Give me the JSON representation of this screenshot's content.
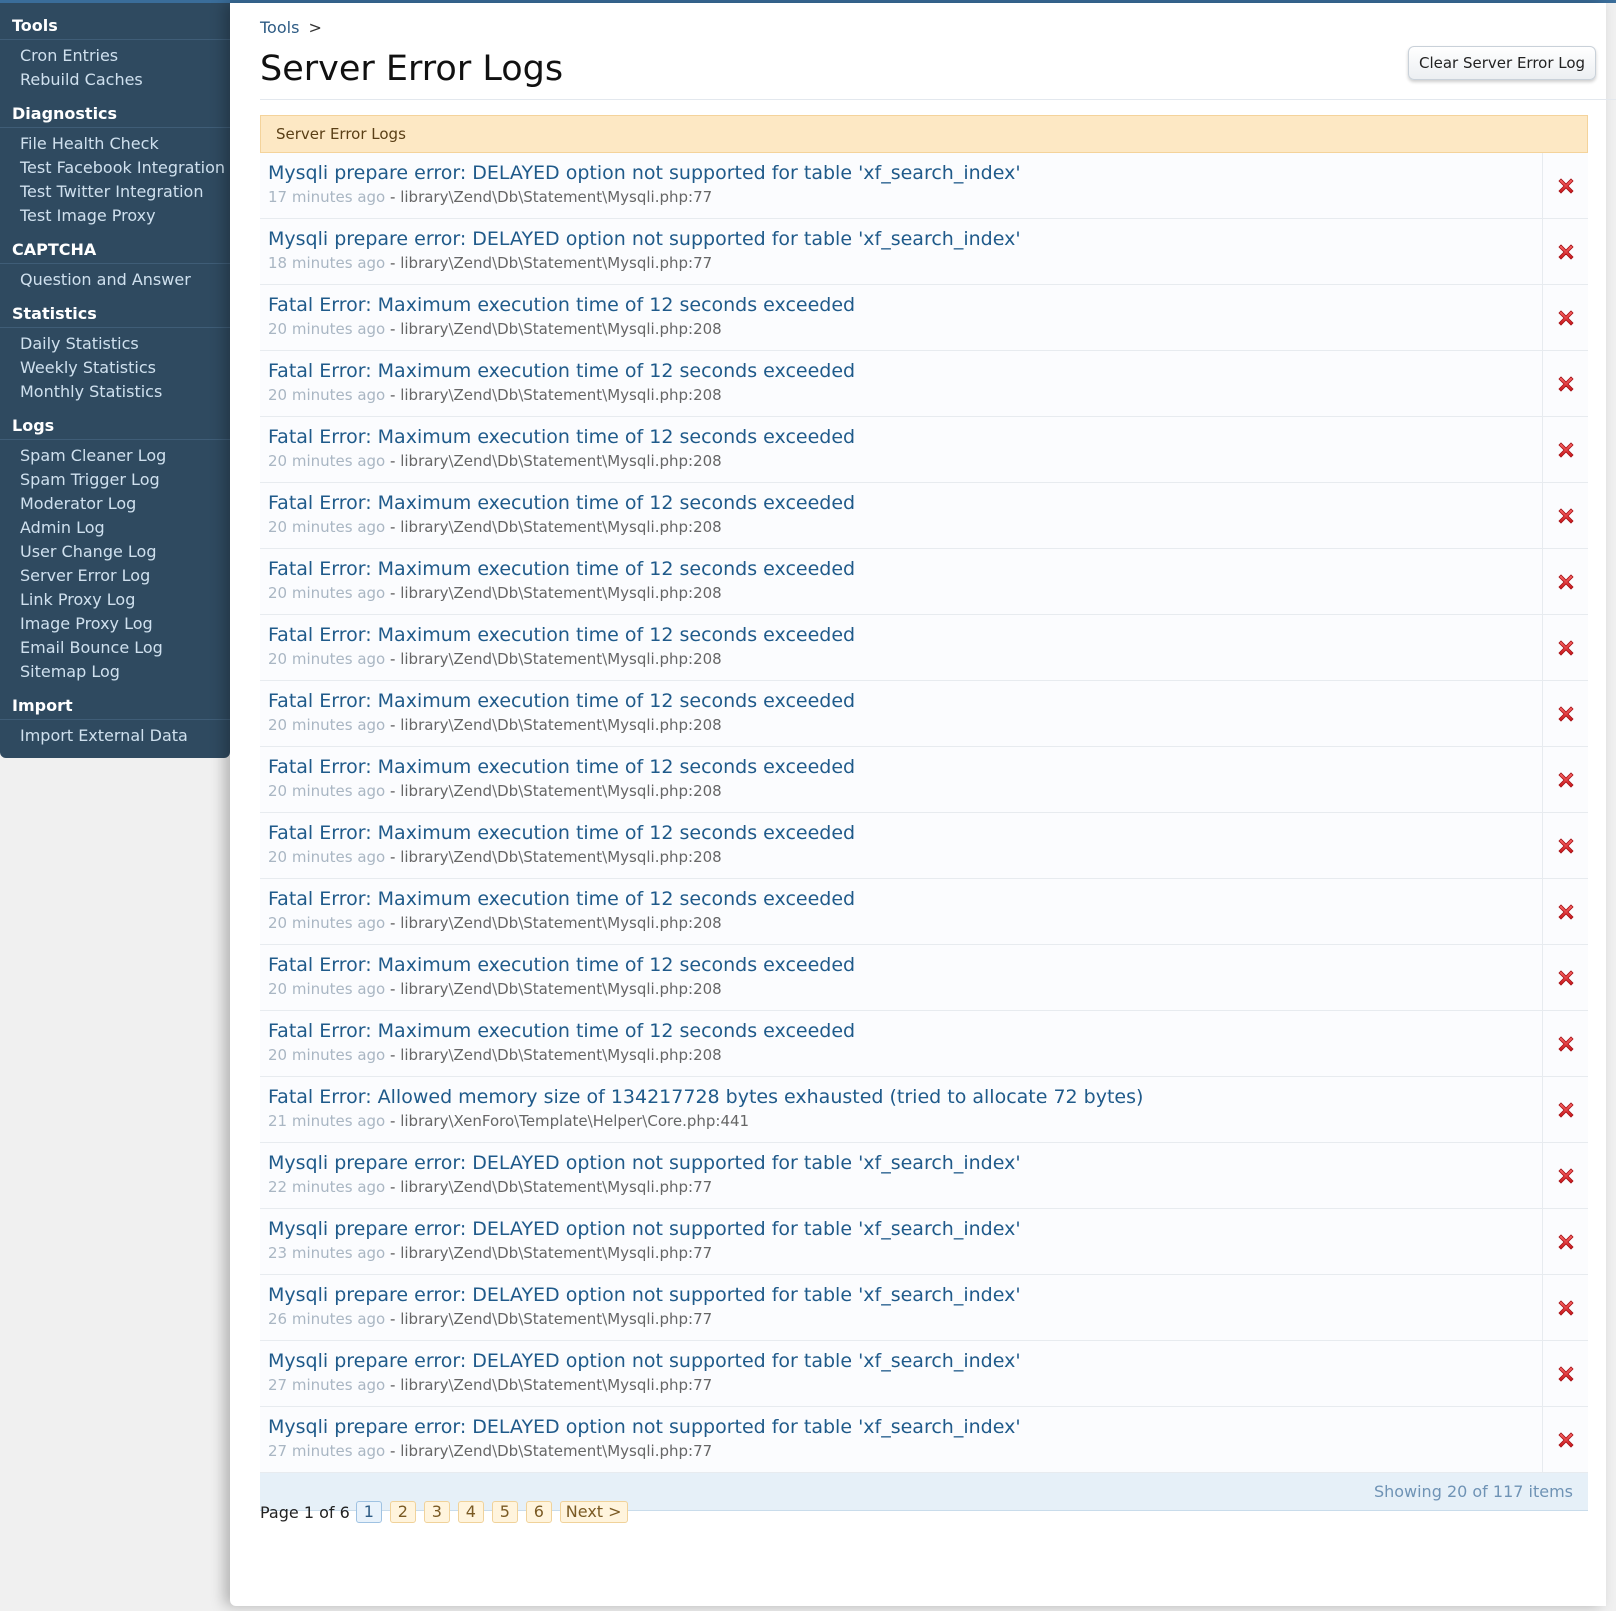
{
  "sidebar": {
    "sections": [
      {
        "title": "Tools",
        "items": [
          "Cron Entries",
          "Rebuild Caches"
        ]
      },
      {
        "title": "Diagnostics",
        "items": [
          "File Health Check",
          "Test Facebook Integration",
          "Test Twitter Integration",
          "Test Image Proxy"
        ]
      },
      {
        "title": "CAPTCHA",
        "items": [
          "Question and Answer"
        ]
      },
      {
        "title": "Statistics",
        "items": [
          "Daily Statistics",
          "Weekly Statistics",
          "Monthly Statistics"
        ]
      },
      {
        "title": "Logs",
        "items": [
          "Spam Cleaner Log",
          "Spam Trigger Log",
          "Moderator Log",
          "Admin Log",
          "User Change Log",
          "Server Error Log",
          "Link Proxy Log",
          "Image Proxy Log",
          "Email Bounce Log",
          "Sitemap Log"
        ]
      },
      {
        "title": "Import",
        "items": [
          "Import External Data"
        ]
      }
    ]
  },
  "breadcrumb": {
    "item": "Tools",
    "separator": ">"
  },
  "page": {
    "title": "Server Error Logs",
    "clear_button": "Clear Server Error Log",
    "panel_header": "Server Error Logs"
  },
  "logs": [
    {
      "message": "Mysqli prepare error: DELAYED option not supported for table 'xf_search_index'",
      "time": "17 minutes ago",
      "file": "library\\Zend\\Db\\Statement\\Mysqli.php:77"
    },
    {
      "message": "Mysqli prepare error: DELAYED option not supported for table 'xf_search_index'",
      "time": "18 minutes ago",
      "file": "library\\Zend\\Db\\Statement\\Mysqli.php:77"
    },
    {
      "message": "Fatal Error: Maximum execution time of 12 seconds exceeded",
      "time": "20 minutes ago",
      "file": "library\\Zend\\Db\\Statement\\Mysqli.php:208"
    },
    {
      "message": "Fatal Error: Maximum execution time of 12 seconds exceeded",
      "time": "20 minutes ago",
      "file": "library\\Zend\\Db\\Statement\\Mysqli.php:208"
    },
    {
      "message": "Fatal Error: Maximum execution time of 12 seconds exceeded",
      "time": "20 minutes ago",
      "file": "library\\Zend\\Db\\Statement\\Mysqli.php:208"
    },
    {
      "message": "Fatal Error: Maximum execution time of 12 seconds exceeded",
      "time": "20 minutes ago",
      "file": "library\\Zend\\Db\\Statement\\Mysqli.php:208"
    },
    {
      "message": "Fatal Error: Maximum execution time of 12 seconds exceeded",
      "time": "20 minutes ago",
      "file": "library\\Zend\\Db\\Statement\\Mysqli.php:208"
    },
    {
      "message": "Fatal Error: Maximum execution time of 12 seconds exceeded",
      "time": "20 minutes ago",
      "file": "library\\Zend\\Db\\Statement\\Mysqli.php:208"
    },
    {
      "message": "Fatal Error: Maximum execution time of 12 seconds exceeded",
      "time": "20 minutes ago",
      "file": "library\\Zend\\Db\\Statement\\Mysqli.php:208"
    },
    {
      "message": "Fatal Error: Maximum execution time of 12 seconds exceeded",
      "time": "20 minutes ago",
      "file": "library\\Zend\\Db\\Statement\\Mysqli.php:208"
    },
    {
      "message": "Fatal Error: Maximum execution time of 12 seconds exceeded",
      "time": "20 minutes ago",
      "file": "library\\Zend\\Db\\Statement\\Mysqli.php:208"
    },
    {
      "message": "Fatal Error: Maximum execution time of 12 seconds exceeded",
      "time": "20 minutes ago",
      "file": "library\\Zend\\Db\\Statement\\Mysqli.php:208"
    },
    {
      "message": "Fatal Error: Maximum execution time of 12 seconds exceeded",
      "time": "20 minutes ago",
      "file": "library\\Zend\\Db\\Statement\\Mysqli.php:208"
    },
    {
      "message": "Fatal Error: Maximum execution time of 12 seconds exceeded",
      "time": "20 minutes ago",
      "file": "library\\Zend\\Db\\Statement\\Mysqli.php:208"
    },
    {
      "message": "Fatal Error: Allowed memory size of 134217728 bytes exhausted (tried to allocate 72 bytes)",
      "time": "21 minutes ago",
      "file": "library\\XenForo\\Template\\Helper\\Core.php:441"
    },
    {
      "message": "Mysqli prepare error: DELAYED option not supported for table 'xf_search_index'",
      "time": "22 minutes ago",
      "file": "library\\Zend\\Db\\Statement\\Mysqli.php:77"
    },
    {
      "message": "Mysqli prepare error: DELAYED option not supported for table 'xf_search_index'",
      "time": "23 minutes ago",
      "file": "library\\Zend\\Db\\Statement\\Mysqli.php:77"
    },
    {
      "message": "Mysqli prepare error: DELAYED option not supported for table 'xf_search_index'",
      "time": "26 minutes ago",
      "file": "library\\Zend\\Db\\Statement\\Mysqli.php:77"
    },
    {
      "message": "Mysqli prepare error: DELAYED option not supported for table 'xf_search_index'",
      "time": "27 minutes ago",
      "file": "library\\Zend\\Db\\Statement\\Mysqli.php:77"
    },
    {
      "message": "Mysqli prepare error: DELAYED option not supported for table 'xf_search_index'",
      "time": "27 minutes ago",
      "file": "library\\Zend\\Db\\Statement\\Mysqli.php:77"
    }
  ],
  "meta_separator": "-",
  "delete_icon": "delete-x-icon",
  "footer": {
    "summary": "Showing 20 of 117 items"
  },
  "pagination": {
    "label": "Page 1 of 6",
    "pages": [
      "1",
      "2",
      "3",
      "4",
      "5",
      "6"
    ],
    "current": "1",
    "next": "Next >"
  },
  "colors": {
    "sidebar_bg": "#2f4a60",
    "link": "#1f5a8a",
    "panel_header_bg": "#fde8c4",
    "delete_red": "#e0262a"
  }
}
